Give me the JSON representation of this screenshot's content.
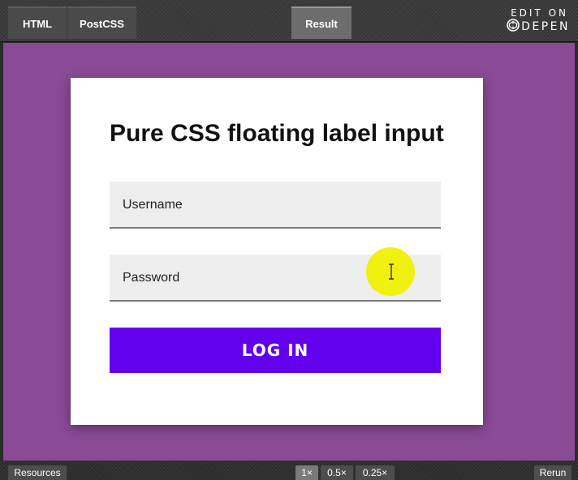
{
  "toolbar": {
    "tabs": [
      {
        "label": "HTML"
      },
      {
        "label": "PostCSS"
      },
      {
        "label": "Result"
      }
    ],
    "codepen": {
      "edit_on": "EDIT ON",
      "brand": "DEPEN",
      "logo_icon": "codepen-cube-icon"
    }
  },
  "card": {
    "title": "Pure CSS floating label input",
    "username_label": "Username",
    "password_label": "Password",
    "login_label": "LOG IN"
  },
  "bottombar": {
    "resources": "Resources",
    "zoom_options": [
      "1×",
      "0.5×",
      "0.25×"
    ],
    "rerun": "Rerun"
  },
  "colors": {
    "preview_bg": "#8a4a96",
    "button_bg": "#6200ee",
    "field_bg": "#eeeeee",
    "highlight": "#f0f000"
  }
}
